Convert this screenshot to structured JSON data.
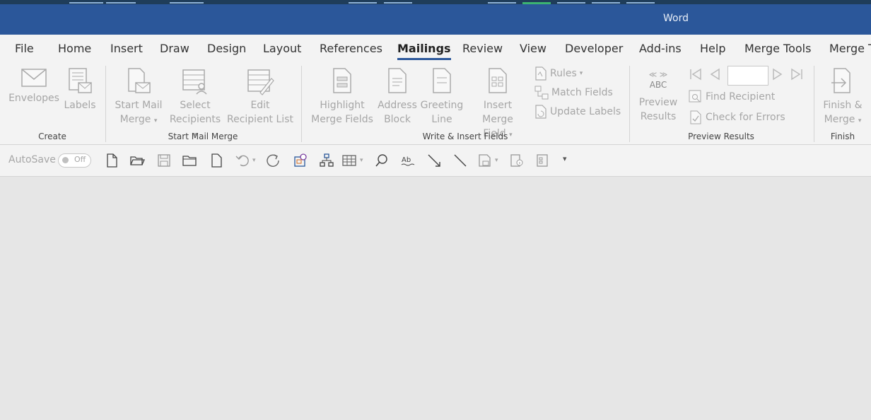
{
  "title_bar": {
    "app_name": "Word"
  },
  "tabs": [
    "File",
    "Home",
    "Insert",
    "Draw",
    "Design",
    "Layout",
    "References",
    "Mailings",
    "Review",
    "View",
    "Developer",
    "Add-ins",
    "Help",
    "Merge Tools",
    "Merge T"
  ],
  "active_tab": "Mailings",
  "ribbon": {
    "create": {
      "envelopes": "Envelopes",
      "labels": "Labels",
      "group": "Create"
    },
    "start_mail_merge": {
      "start_line1": "Start Mail",
      "start_line2": "Merge",
      "select_line1": "Select",
      "select_line2": "Recipients",
      "edit_line1": "Edit",
      "edit_line2": "Recipient List",
      "group": "Start Mail Merge"
    },
    "write_insert": {
      "highlight_line1": "Highlight",
      "highlight_line2": "Merge Fields",
      "address_line1": "Address",
      "address_line2": "Block",
      "greeting_line1": "Greeting",
      "greeting_line2": "Line",
      "insert_line1": "Insert Merge",
      "insert_line2": "Field",
      "rules": "Rules",
      "match_fields": "Match Fields",
      "update_labels": "Update Labels",
      "group": "Write & Insert Fields"
    },
    "preview": {
      "abc": "ABC",
      "preview_line1": "Preview",
      "preview_line2": "Results",
      "record_value": "",
      "find_recipient": "Find Recipient",
      "check_errors": "Check for Errors",
      "group": "Preview Results"
    },
    "finish": {
      "finish_line1": "Finish &",
      "finish_line2": "Merge",
      "group": "Finish"
    }
  },
  "quick_access": {
    "autosave_label": "AutoSave",
    "autosave_state": "Off"
  },
  "colors": {
    "title_bar": "#2b579a",
    "ribbon_bg": "#f3f3f3",
    "disabled_text": "#a6a6a6",
    "document_bg": "#e6e6e6"
  }
}
